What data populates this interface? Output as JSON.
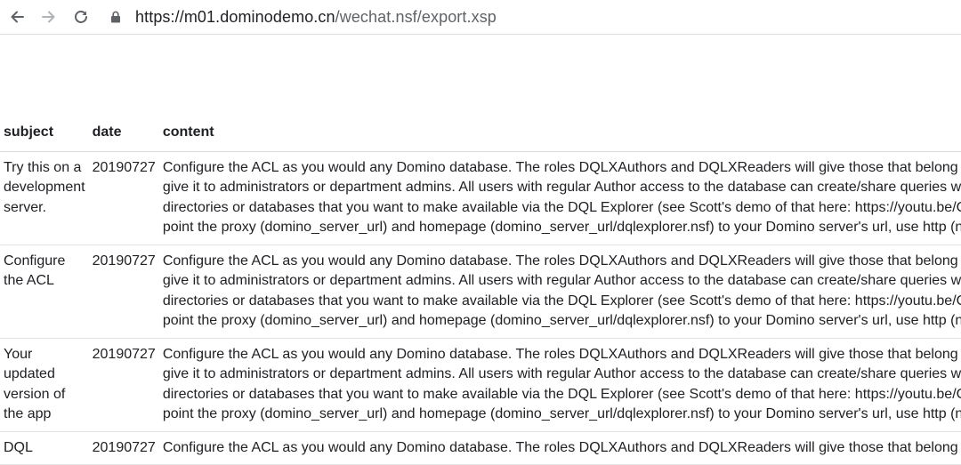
{
  "browser": {
    "back_icon": "arrow-left-icon",
    "forward_icon": "arrow-right-icon",
    "reload_icon": "reload-icon",
    "lock_icon": "lock-icon",
    "url_domain": "https://m01.dominodemo.cn",
    "url_path": "/wechat.nsf/export.xsp"
  },
  "table": {
    "headers": {
      "subject": "subject",
      "date": "date",
      "content": "content"
    },
    "rows": [
      {
        "subject_lines": [
          "Try this on a",
          "development",
          "server."
        ],
        "date": "20190727",
        "content_lines": [
          "Configure the ACL as you would any Domino database. The roles DQLXAuthors and DQLXReaders will give those that belong",
          "give it to administrators or department admins. All users with regular Author access to the database can create/share queries w",
          "directories or databases that you want to make available via the DQL Explorer (see Scott's demo of that here: https://youtu.be/C",
          "point the proxy (domino_server_url) and homepage (domino_server_url/dqlexplorer.nsf) to your Domino server's url, use http (n"
        ]
      },
      {
        "subject_lines": [
          "Configure",
          "the ACL"
        ],
        "date": "20190727",
        "content_lines": [
          "Configure the ACL as you would any Domino database. The roles DQLXAuthors and DQLXReaders will give those that belong",
          "give it to administrators or department admins. All users with regular Author access to the database can create/share queries w",
          "directories or databases that you want to make available via the DQL Explorer (see Scott's demo of that here: https://youtu.be/C",
          "point the proxy (domino_server_url) and homepage (domino_server_url/dqlexplorer.nsf) to your Domino server's url, use http (n"
        ]
      },
      {
        "subject_lines": [
          "Your",
          "updated",
          "version of",
          "the app"
        ],
        "date": "20190727",
        "content_lines": [
          "Configure the ACL as you would any Domino database. The roles DQLXAuthors and DQLXReaders will give those that belong",
          "give it to administrators or department admins. All users with regular Author access to the database can create/share queries w",
          "directories or databases that you want to make available via the DQL Explorer (see Scott's demo of that here: https://youtu.be/C",
          "point the proxy (domino_server_url) and homepage (domino_server_url/dqlexplorer.nsf) to your Domino server's url, use http (n"
        ]
      },
      {
        "subject_lines": [
          "DQL"
        ],
        "date": "20190727",
        "content_lines": [
          "Configure the ACL as you would any Domino database. The roles DQLXAuthors and DQLXReaders will give those that belong"
        ]
      }
    ]
  }
}
